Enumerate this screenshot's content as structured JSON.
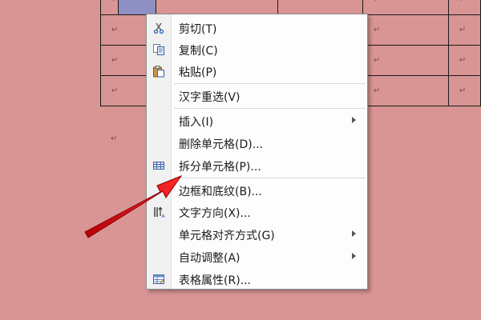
{
  "document": {
    "paragraph_mark": "↵"
  },
  "menu": {
    "items": [
      {
        "label": "剪切(T)",
        "icon": "scissors-icon"
      },
      {
        "label": "复制(C)",
        "icon": "copy-icon"
      },
      {
        "label": "粘贴(P)",
        "icon": "paste-icon"
      },
      {
        "label": "汉字重选(V)"
      },
      {
        "label": "插入(I)",
        "submenu": true
      },
      {
        "label": "删除单元格(D)..."
      },
      {
        "label": "拆分单元格(P)...",
        "icon": "split-cells-icon"
      },
      {
        "label": "边框和底纹(B)..."
      },
      {
        "label": "文字方向(X)...",
        "icon": "text-direction-icon"
      },
      {
        "label": "单元格对齐方式(G)",
        "submenu": true
      },
      {
        "label": "自动调整(A)",
        "submenu": true
      },
      {
        "label": "表格属性(R)...",
        "icon": "table-properties-icon"
      }
    ]
  },
  "colors": {
    "page_background": "#d99594",
    "annotation_arrow": "#e8101a",
    "selection": "#8e8fc2"
  }
}
